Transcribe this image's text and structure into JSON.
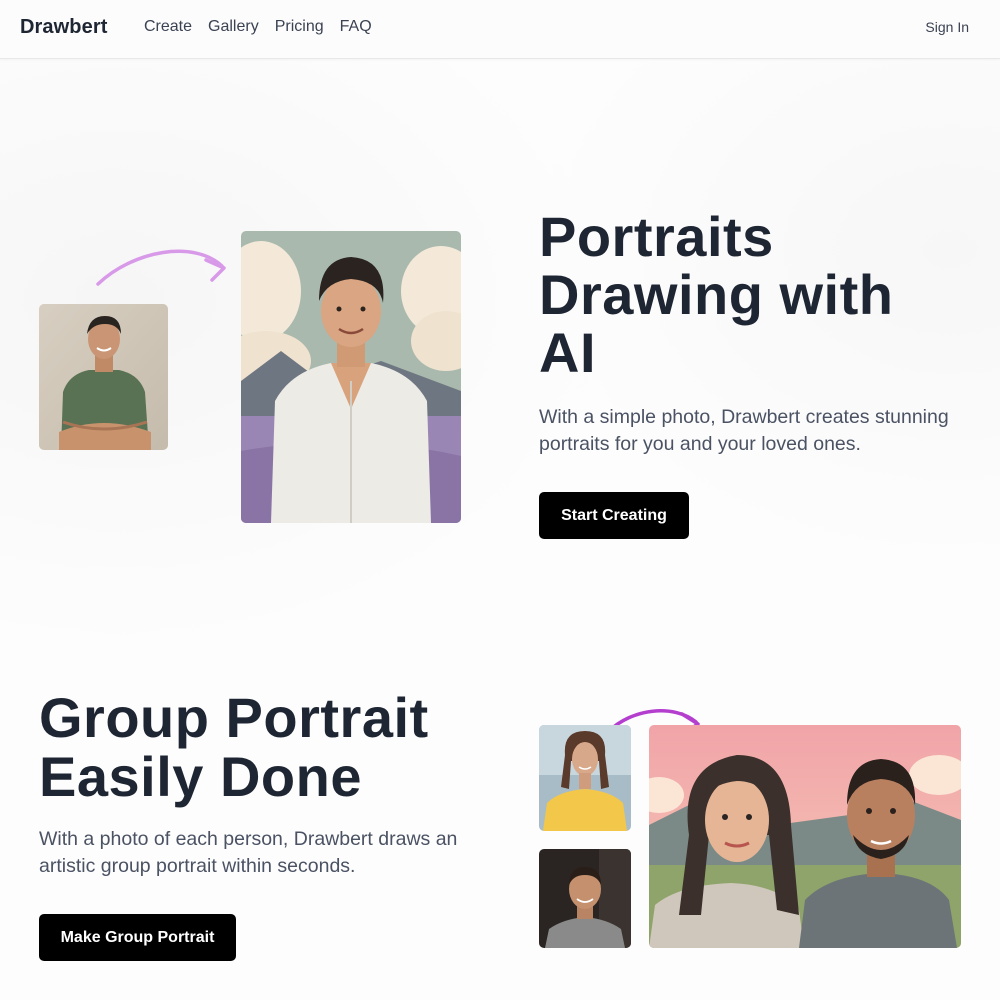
{
  "nav": {
    "brand": "Drawbert",
    "links": [
      "Create",
      "Gallery",
      "Pricing",
      "FAQ"
    ],
    "signin": "Sign In"
  },
  "hero": {
    "title_lines": [
      "Portraits",
      "Drawing with",
      "AI"
    ],
    "description_lines": [
      "With a simple photo, Drawbert creates stunning",
      "portraits for you and your loved ones."
    ],
    "cta": "Start Creating"
  },
  "group": {
    "title_lines": [
      "Group Portrait",
      "Easily Done"
    ],
    "description_lines": [
      "With a photo of each person, Drawbert draws an",
      "artistic group portrait within seconds."
    ],
    "cta": "Make Group Portrait"
  },
  "colors": {
    "arrow_light": "#d89ae8",
    "arrow_dark": "#b43fcf",
    "button_bg": "#000000"
  }
}
